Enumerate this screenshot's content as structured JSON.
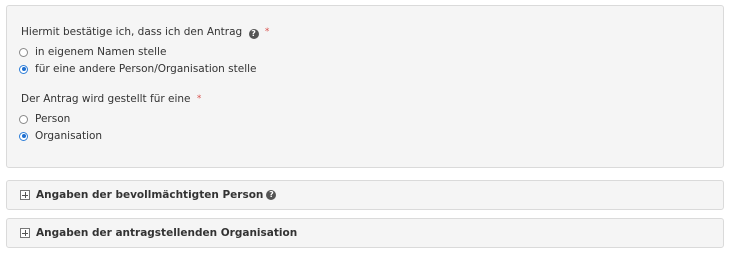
{
  "confirmation": {
    "question": "Hiermit bestätige ich, dass ich den Antrag",
    "required_mark": "*",
    "help_icon": "question-circle-icon",
    "options": [
      {
        "label": "in eigenem Namen stelle",
        "selected": false
      },
      {
        "label": "für eine andere Person/Organisation stelle",
        "selected": true
      }
    ]
  },
  "applicant_type": {
    "question": "Der Antrag wird gestellt für eine",
    "required_mark": "*",
    "options": [
      {
        "label": "Person",
        "selected": false
      },
      {
        "label": "Organisation",
        "selected": true
      }
    ]
  },
  "accordions": [
    {
      "title": "Angaben der bevollmächtigten Person",
      "has_help": true,
      "icon": "plus-square-icon"
    },
    {
      "title": "Angaben der antragstellenden Organisation",
      "has_help": false,
      "icon": "plus-square-icon"
    }
  ],
  "colors": {
    "accent": "#1f6fd0",
    "required": "#d9534f",
    "panel_bg": "#f5f5f5",
    "border": "#dadada"
  }
}
